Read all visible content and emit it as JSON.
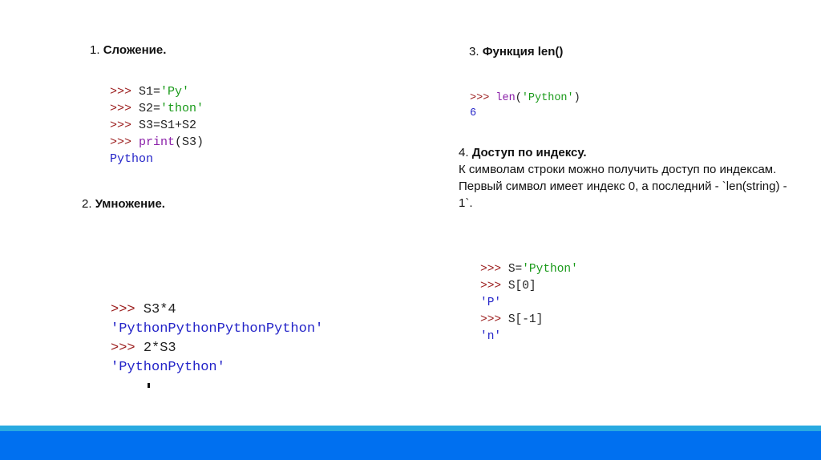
{
  "sections": {
    "s1": {
      "number": "1. ",
      "title": "Сложение."
    },
    "s2": {
      "number": "2. ",
      "title": "Умножение."
    },
    "s3": {
      "number": "3. ",
      "title": "Функция len()"
    },
    "s4": {
      "number": "4. ",
      "title": "Доступ по индексу.",
      "body": "К символам строки можно получить доступ по индексам. Первый символ имеет индекс 0, а последний - `len(string) - 1`."
    }
  },
  "code": {
    "add": [
      [
        [
          "p",
          ">>> "
        ],
        [
          "n",
          "S1="
        ],
        [
          "s",
          "'Py'"
        ]
      ],
      [
        [
          "p",
          ">>> "
        ],
        [
          "n",
          "S2="
        ],
        [
          "s",
          "'thon'"
        ]
      ],
      [
        [
          "p",
          ">>> "
        ],
        [
          "n",
          "S3=S1+S2"
        ]
      ],
      [
        [
          "p",
          ">>> "
        ],
        [
          "k",
          "print"
        ],
        [
          "n",
          "(S3)"
        ]
      ],
      [
        [
          "o",
          "Python"
        ]
      ]
    ],
    "mul": [
      [
        [
          "p",
          ">>> "
        ],
        [
          "n",
          "S3*4"
        ]
      ],
      [
        [
          "o",
          "'PythonPythonPythonPython'"
        ]
      ],
      [
        [
          "p",
          ">>> "
        ],
        [
          "n",
          "2*S3"
        ]
      ],
      [
        [
          "o",
          "'PythonPython'"
        ]
      ]
    ],
    "len": [
      [
        [
          "p",
          ">>> "
        ],
        [
          "k",
          "len"
        ],
        [
          "n",
          "("
        ],
        [
          "s",
          "'Python'"
        ],
        [
          "n",
          ")"
        ]
      ],
      [
        [
          "o",
          "6"
        ]
      ]
    ],
    "index": [
      [
        [
          "p",
          ">>> "
        ],
        [
          "n",
          "S="
        ],
        [
          "s",
          "'Python'"
        ]
      ],
      [
        [
          "p",
          ">>> "
        ],
        [
          "n",
          "S[0]"
        ]
      ],
      [
        [
          "o",
          "'P'"
        ]
      ],
      [
        [
          "p",
          ">>> "
        ],
        [
          "n",
          "S[-1]"
        ]
      ],
      [
        [
          "o",
          "'n'"
        ]
      ]
    ]
  },
  "colors": {
    "stripe": "#29aae1",
    "footer": "#0070f0"
  }
}
